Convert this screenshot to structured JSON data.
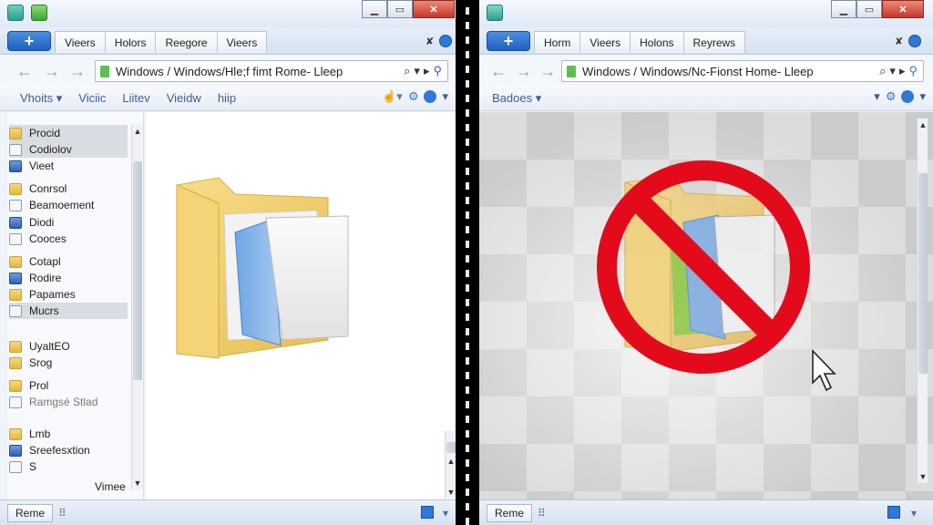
{
  "left": {
    "tabs": [
      "Vieers",
      "Holors",
      "Reegore",
      "Vieers"
    ],
    "new_tab_label": "+",
    "address": "Windows / Windows/Hle;f fimt Rome- Lleep",
    "commands": [
      "Vhoits",
      "Viciic",
      "Liitev",
      "Vieidw",
      "hiip"
    ],
    "nav_items": [
      "Procid",
      "Codiolov",
      "Vieet",
      "Conrsol",
      "Beamoement",
      "Diodi",
      "Cooces",
      "Cotapl",
      "Rodire",
      "Papames",
      "Mucrs",
      "UyaltEO",
      "Srog",
      "Prol",
      "Ramgsé Stlad",
      "Lmb",
      "Sreefesxtion",
      "S"
    ],
    "nav_footer": "Vimee",
    "status_label": "Reme"
  },
  "right": {
    "tabs": [
      "Horm",
      "Vieers",
      "Holons",
      "Reyrews"
    ],
    "new_tab_label": "+",
    "address": "Windows / Windows/Nc-Fionst Home- Lleep",
    "commands": [
      "Badoes"
    ],
    "status_label": "Reme"
  },
  "colors": {
    "accent": "#2f78d8",
    "prohibit": "#e30b1b",
    "folder": "#f0cc6a"
  },
  "icons": [
    "app-icon",
    "folder-icon",
    "minimize-icon",
    "maximize-icon",
    "close-icon",
    "back-arrow-icon",
    "forward-arrow-icon",
    "search-icon",
    "refresh-icon",
    "help-icon",
    "no-entry-icon",
    "mouse-pointer-icon"
  ]
}
